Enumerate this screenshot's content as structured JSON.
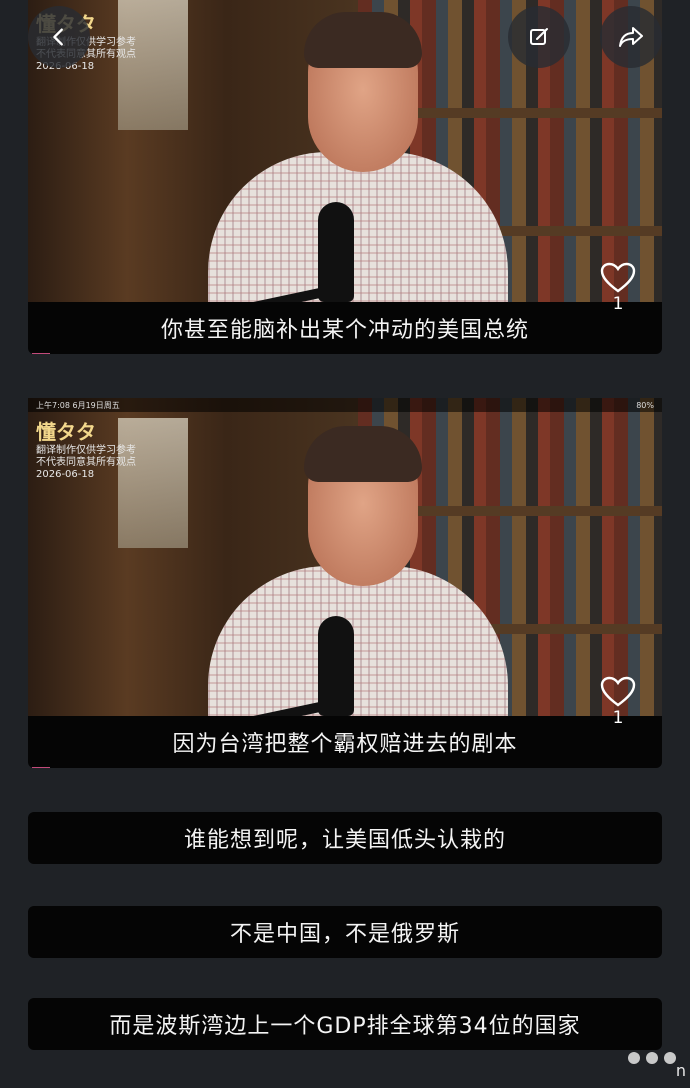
{
  "nav": {
    "back_icon": "chevron-left-icon",
    "edit_icon": "edit-icon",
    "share_icon": "share-icon"
  },
  "panels": [
    {
      "caption": "你甚至能脑补出某个冲动的美国总统",
      "like_count": "1",
      "watermark": {
        "brand": "懂タタ",
        "line1": "翻译制作仅供学习参考",
        "line2": "不代表同意其所有观点",
        "date": "2026-06-18"
      }
    },
    {
      "caption": "因为台湾把整个霸权赔进去的剧本",
      "like_count": "1",
      "status": {
        "time": "上午7:08  6月19日周五",
        "battery": "80%"
      },
      "watermark": {
        "brand": "懂タタ",
        "line1": "翻译制作仅供学习参考",
        "line2": "不代表同意其所有观点",
        "date": "2026-06-18"
      }
    }
  ],
  "captions": [
    "谁能想到呢，让美国低头认栽的",
    "不是中国，不是俄罗斯",
    "而是波斯湾边上一个GDP排全球第34位的国家"
  ],
  "corner_text": "n"
}
